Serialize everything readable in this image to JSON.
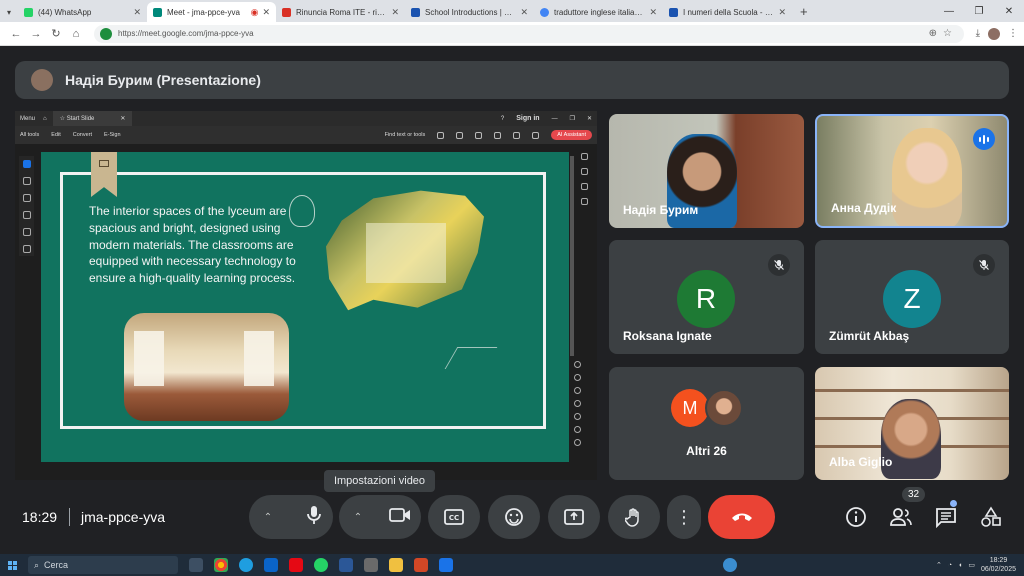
{
  "browser": {
    "tabs": [
      {
        "title": "(44) WhatsApp",
        "color": "#25d366"
      },
      {
        "title": "Meet - jma-ppce-yva",
        "color": "#00897b",
        "active": true
      },
      {
        "title": "Rinuncia Roma ITE - richiesta c...",
        "color": "#d93025"
      },
      {
        "title": "School Introductions | Europea...",
        "color": "#1a53b0"
      },
      {
        "title": "traduttore inglese italiano - Co...",
        "color": "#4285f4"
      },
      {
        "title": "I numeri della Scuola - IIS E.SIC...",
        "color": "#1a53b0"
      }
    ],
    "url": "https://meet.google.com/jma-ppce-yva"
  },
  "meeting": {
    "presenter_title": "Надія Бурим (Presentazione)",
    "time": "18:29",
    "code": "jma-ppce-yva",
    "participant_count": "32",
    "tooltip": "Impostazioni video"
  },
  "pdf_viewer": {
    "menu_label": "Menu",
    "tab_title": "Start Slide",
    "sign_in": "Sign in",
    "menu_items": [
      "All tools",
      "Edit",
      "Convert",
      "E-Sign"
    ],
    "find_placeholder": "Find text or tools",
    "ai_label": "AI Assistant"
  },
  "slide": {
    "text": "The interior spaces of the lyceum are spacious and bright, designed using modern materials. The classrooms are equipped with necessary technology to ensure a high-quality learning process."
  },
  "participants": [
    {
      "name": "Надія Бурим"
    },
    {
      "name": "Анна Дудік",
      "speaking": true
    },
    {
      "name": "Roksana Ignate",
      "initial": "R",
      "color": "#1e7a34",
      "muted": true
    },
    {
      "name": "Zümrüt Akbaş",
      "initial": "Z",
      "color": "#12848f",
      "muted": true
    },
    {
      "name": "Altri 26",
      "initial": "M",
      "color": "#f4511e"
    },
    {
      "name": "Alba Giglio"
    }
  ],
  "taskbar": {
    "search_placeholder": "Cerca",
    "clock_time": "18:29",
    "clock_date": "06/02/2025"
  }
}
